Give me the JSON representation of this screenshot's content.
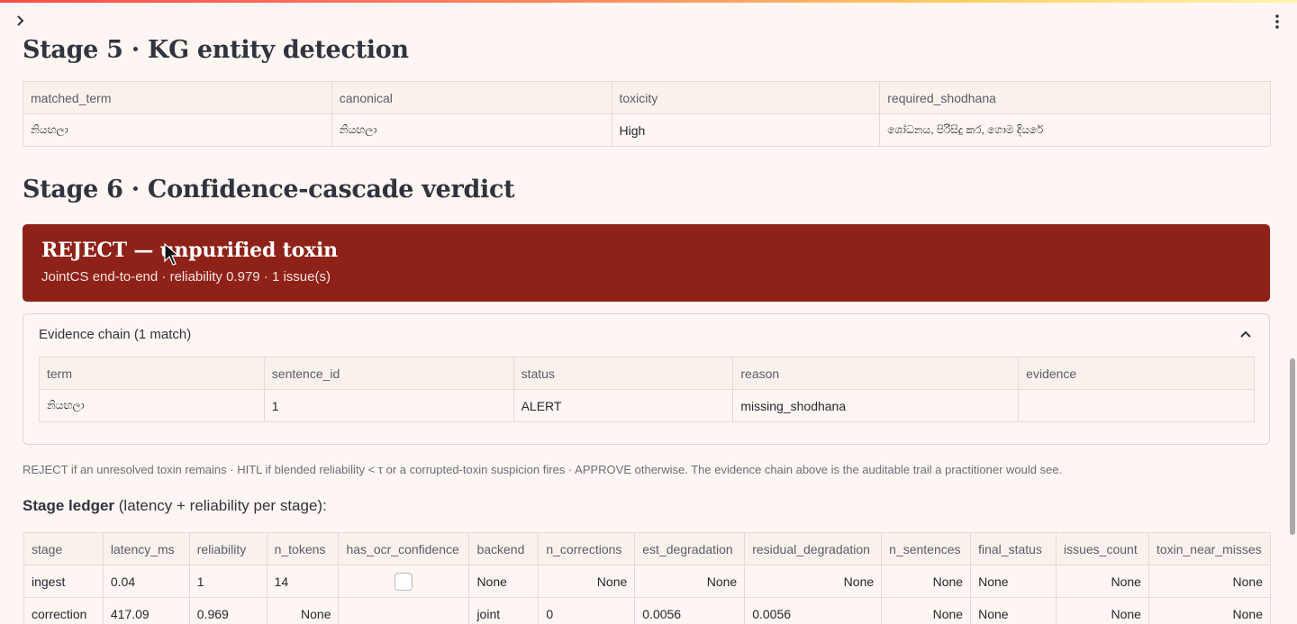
{
  "colors": {
    "verdict_bg": "#8e2219",
    "background": "#fdf6f2",
    "accent_stripe": "#ff4b4b"
  },
  "icons": {
    "sidebar_toggle": "chevron-right-icon",
    "menu": "kebab-menu-icon",
    "expander": "chevron-up-icon",
    "pointer": "mouse-cursor-icon"
  },
  "stage5": {
    "title": "Stage 5 · KG entity detection",
    "columns": [
      "matched_term",
      "canonical",
      "toxicity",
      "required_shodhana"
    ],
    "rows": [
      [
        "නියඟලා",
        "නියඟලා",
        "High",
        "ශෝධනය, පිරිසිදු කර, ගොම දියරේ"
      ]
    ]
  },
  "stage6": {
    "title": "Stage 6 · Confidence-cascade verdict",
    "verdict_title": "REJECT — unpurified toxin",
    "verdict_sub": "JointCS end-to-end · reliability 0.979 · 1 issue(s)",
    "evidence_label": "Evidence chain (1 match)",
    "evidence_columns": [
      "term",
      "sentence_id",
      "status",
      "reason",
      "evidence"
    ],
    "evidence_rows": [
      [
        "නියඟලා",
        "1",
        "ALERT",
        "missing_shodhana",
        ""
      ]
    ],
    "caption": "REJECT if an unresolved toxin remains · HITL if blended reliability < τ or a corrupted-toxin suspicion fires · APPROVE otherwise. The evidence chain above is the auditable trail a practitioner would see."
  },
  "ledger": {
    "title_bold": "Stage ledger",
    "title_rest": " (latency + reliability per stage):",
    "columns": [
      "stage",
      "latency_ms",
      "reliability",
      "n_tokens",
      "has_ocr_confidence",
      "backend",
      "n_corrections",
      "est_degradation",
      "residual_degradation",
      "n_sentences",
      "final_status",
      "issues_count",
      "toxin_near_misses"
    ],
    "rows": [
      [
        "ingest",
        "0.04",
        "1",
        "14",
        "",
        "None",
        "None",
        "None",
        "None",
        "None",
        "None",
        "None",
        "None"
      ],
      [
        "correction",
        "417.09",
        "0.969",
        "None",
        "",
        "joint",
        "0",
        "0.0056",
        "0.0056",
        "None",
        "None",
        "None",
        "None"
      ]
    ]
  }
}
